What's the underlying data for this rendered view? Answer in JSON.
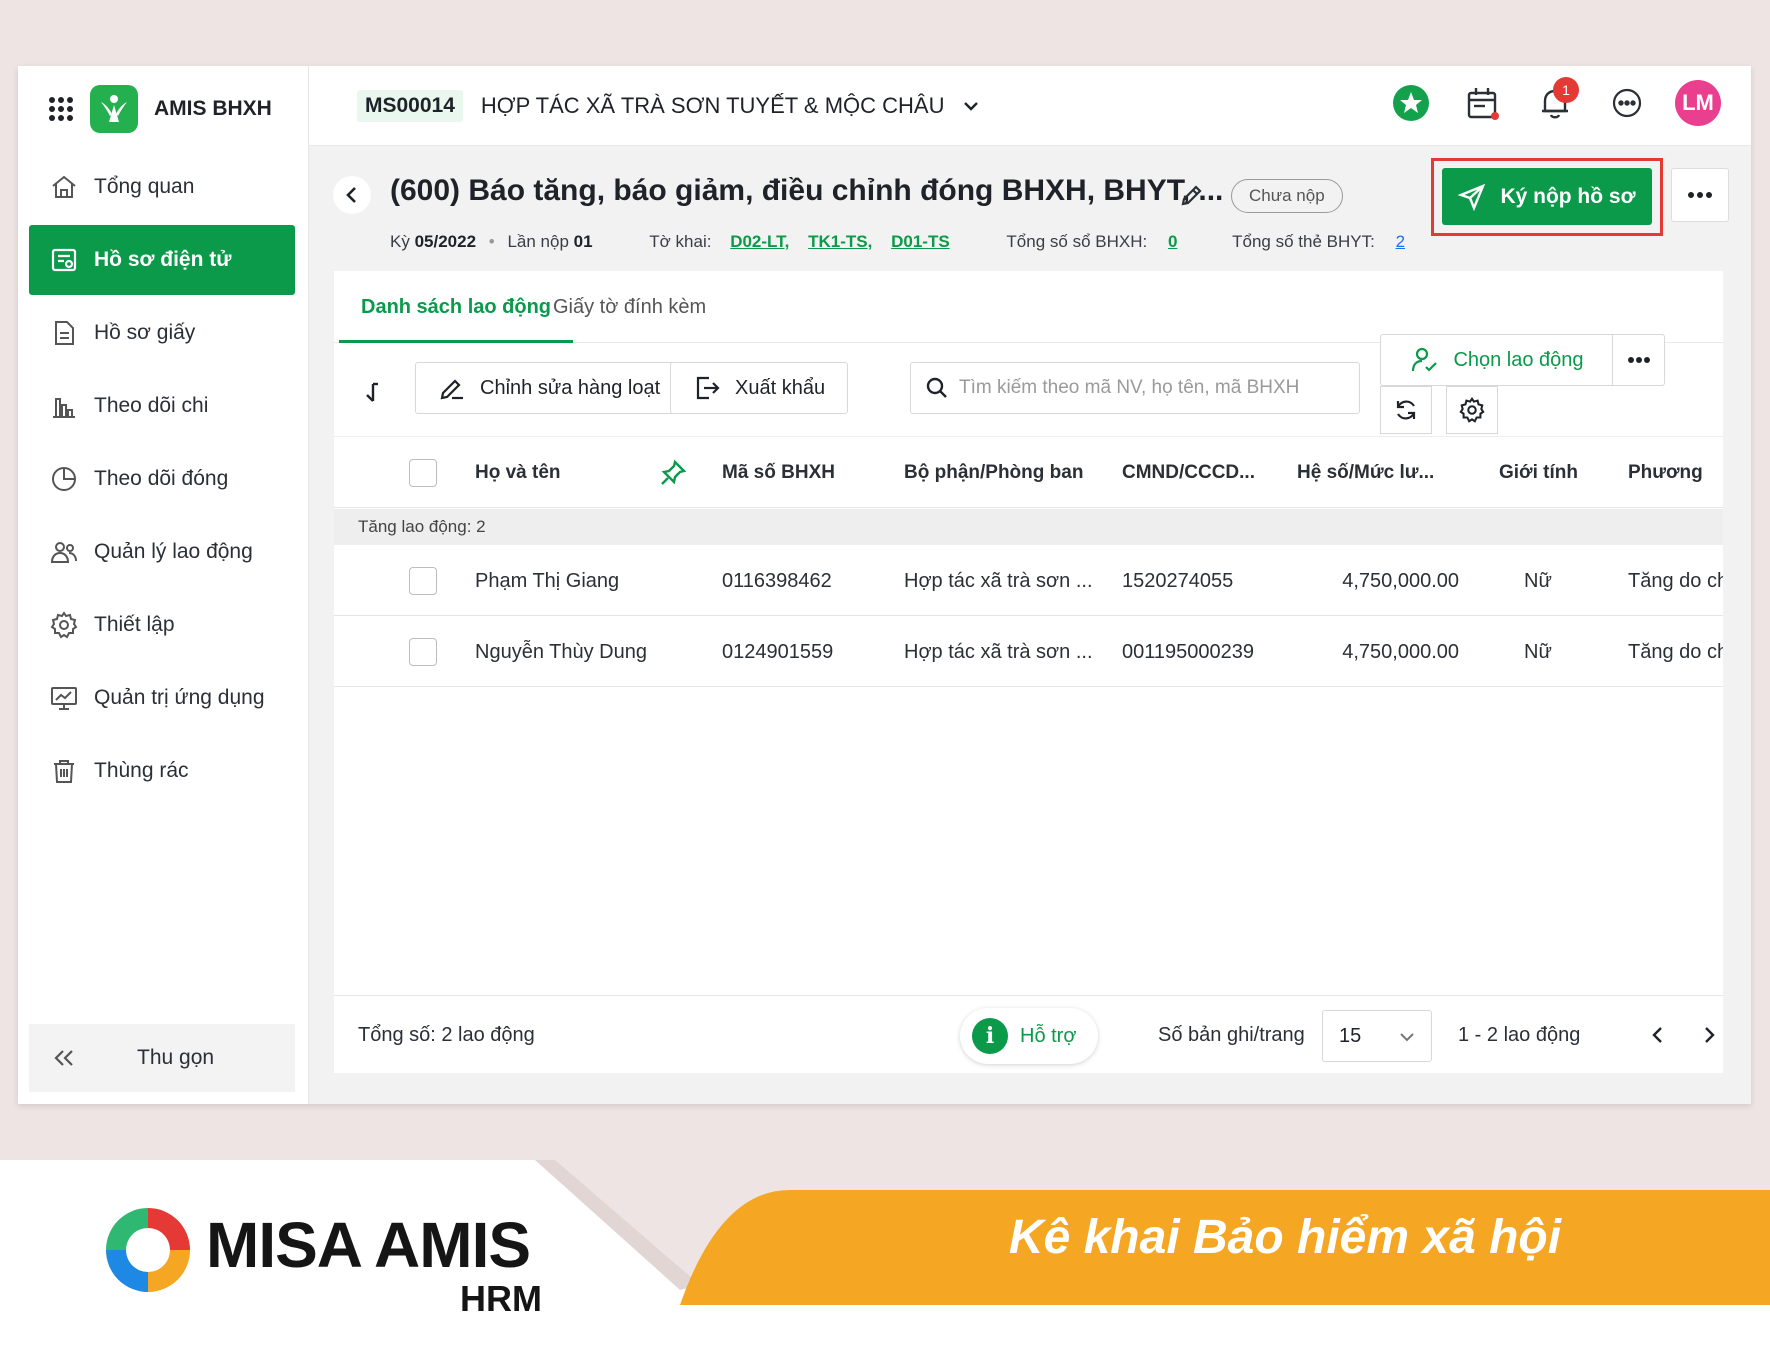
{
  "app": {
    "name": "AMIS BHXH"
  },
  "sidebar": {
    "items": [
      {
        "label": "Tổng quan",
        "icon": "home-icon"
      },
      {
        "label": "Hồ sơ điện tử",
        "icon": "e-document-icon",
        "active": true
      },
      {
        "label": "Hồ sơ giấy",
        "icon": "paper-document-icon"
      },
      {
        "label": "Theo dõi chi",
        "icon": "bar-chart-icon"
      },
      {
        "label": "Theo dõi đóng",
        "icon": "pie-chart-icon"
      },
      {
        "label": "Quản lý lao động",
        "icon": "people-icon"
      },
      {
        "label": "Thiết lập",
        "icon": "gear-icon"
      },
      {
        "label": "Quản trị ứng dụng",
        "icon": "monitor-chart-icon"
      },
      {
        "label": "Thùng rác",
        "icon": "trash-icon"
      }
    ],
    "collapse_label": "Thu gọn"
  },
  "topbar": {
    "org_code": "MS00014",
    "org_name": "HỢP TÁC XÃ TRÀ SƠN TUYẾT & MỘC CHÂU",
    "notification_count": "1",
    "avatar_initials": "LM"
  },
  "header": {
    "title": "(600) Báo tăng, báo giảm, điều chỉnh đóng BHXH, BHYT, ...",
    "status": "Chưa nộp",
    "submit_label": "Ký nộp hồ sơ",
    "period_label": "Kỳ",
    "period_value": "05/2022",
    "submission_label": "Lần nộp",
    "submission_value": "01",
    "forms_label": "Tờ khai:",
    "forms": [
      "D02-LT,",
      "TK1-TS,",
      "D01-TS"
    ],
    "bhxh_total_label": "Tổng số sổ BHXH:",
    "bhxh_total_value": "0",
    "bhyt_total_label": "Tổng số thẻ BHYT:",
    "bhyt_total_value": "2"
  },
  "tabs": [
    {
      "label": "Danh sách lao động",
      "active": true
    },
    {
      "label": "Giấy tờ đính kèm",
      "active": false
    }
  ],
  "toolbar": {
    "bulk_edit_label": "Chỉnh sửa hàng loạt",
    "export_label": "Xuất khẩu",
    "search_placeholder": "Tìm kiếm theo mã NV, họ tên, mã BHXH",
    "choose_label": "Chọn lao động"
  },
  "table": {
    "columns": [
      "Họ và tên",
      "Mã số BHXH",
      "Bộ phận/Phòng ban",
      "CMND/CCCD...",
      "Hệ số/Mức lư...",
      "Giới tính",
      "Phương"
    ],
    "group_label": "Tăng lao động: 2",
    "rows": [
      {
        "name": "Phạm Thị Giang",
        "bhxh": "0116398462",
        "dept": "Hợp tác xã trà sơn ...",
        "id": "1520274055",
        "salary": "4,750,000.00",
        "gender": "Nữ",
        "method": "Tăng do ch"
      },
      {
        "name": "Nguyễn Thùy Dung",
        "bhxh": "0124901559",
        "dept": "Hợp tác xã trà sơn ...",
        "id": "001195000239",
        "salary": "4,750,000.00",
        "gender": "Nữ",
        "method": "Tăng do ch"
      }
    ]
  },
  "footer": {
    "total_label": "Tổng số: 2 lao động",
    "help_label": "Hỗ trợ",
    "per_page_label": "Số bản ghi/trang",
    "per_page_value": "15",
    "range_label": "1 - 2 lao động"
  },
  "banner": {
    "brand": "MISA AMIS",
    "product": "HRM",
    "slogan": "Kê khai Bảo hiểm xã hội"
  },
  "colors": {
    "primary_green": "#0a9a4a",
    "highlight_red": "#e53935",
    "banner_orange": "#f5a623",
    "avatar_pink": "#e93f8e"
  }
}
